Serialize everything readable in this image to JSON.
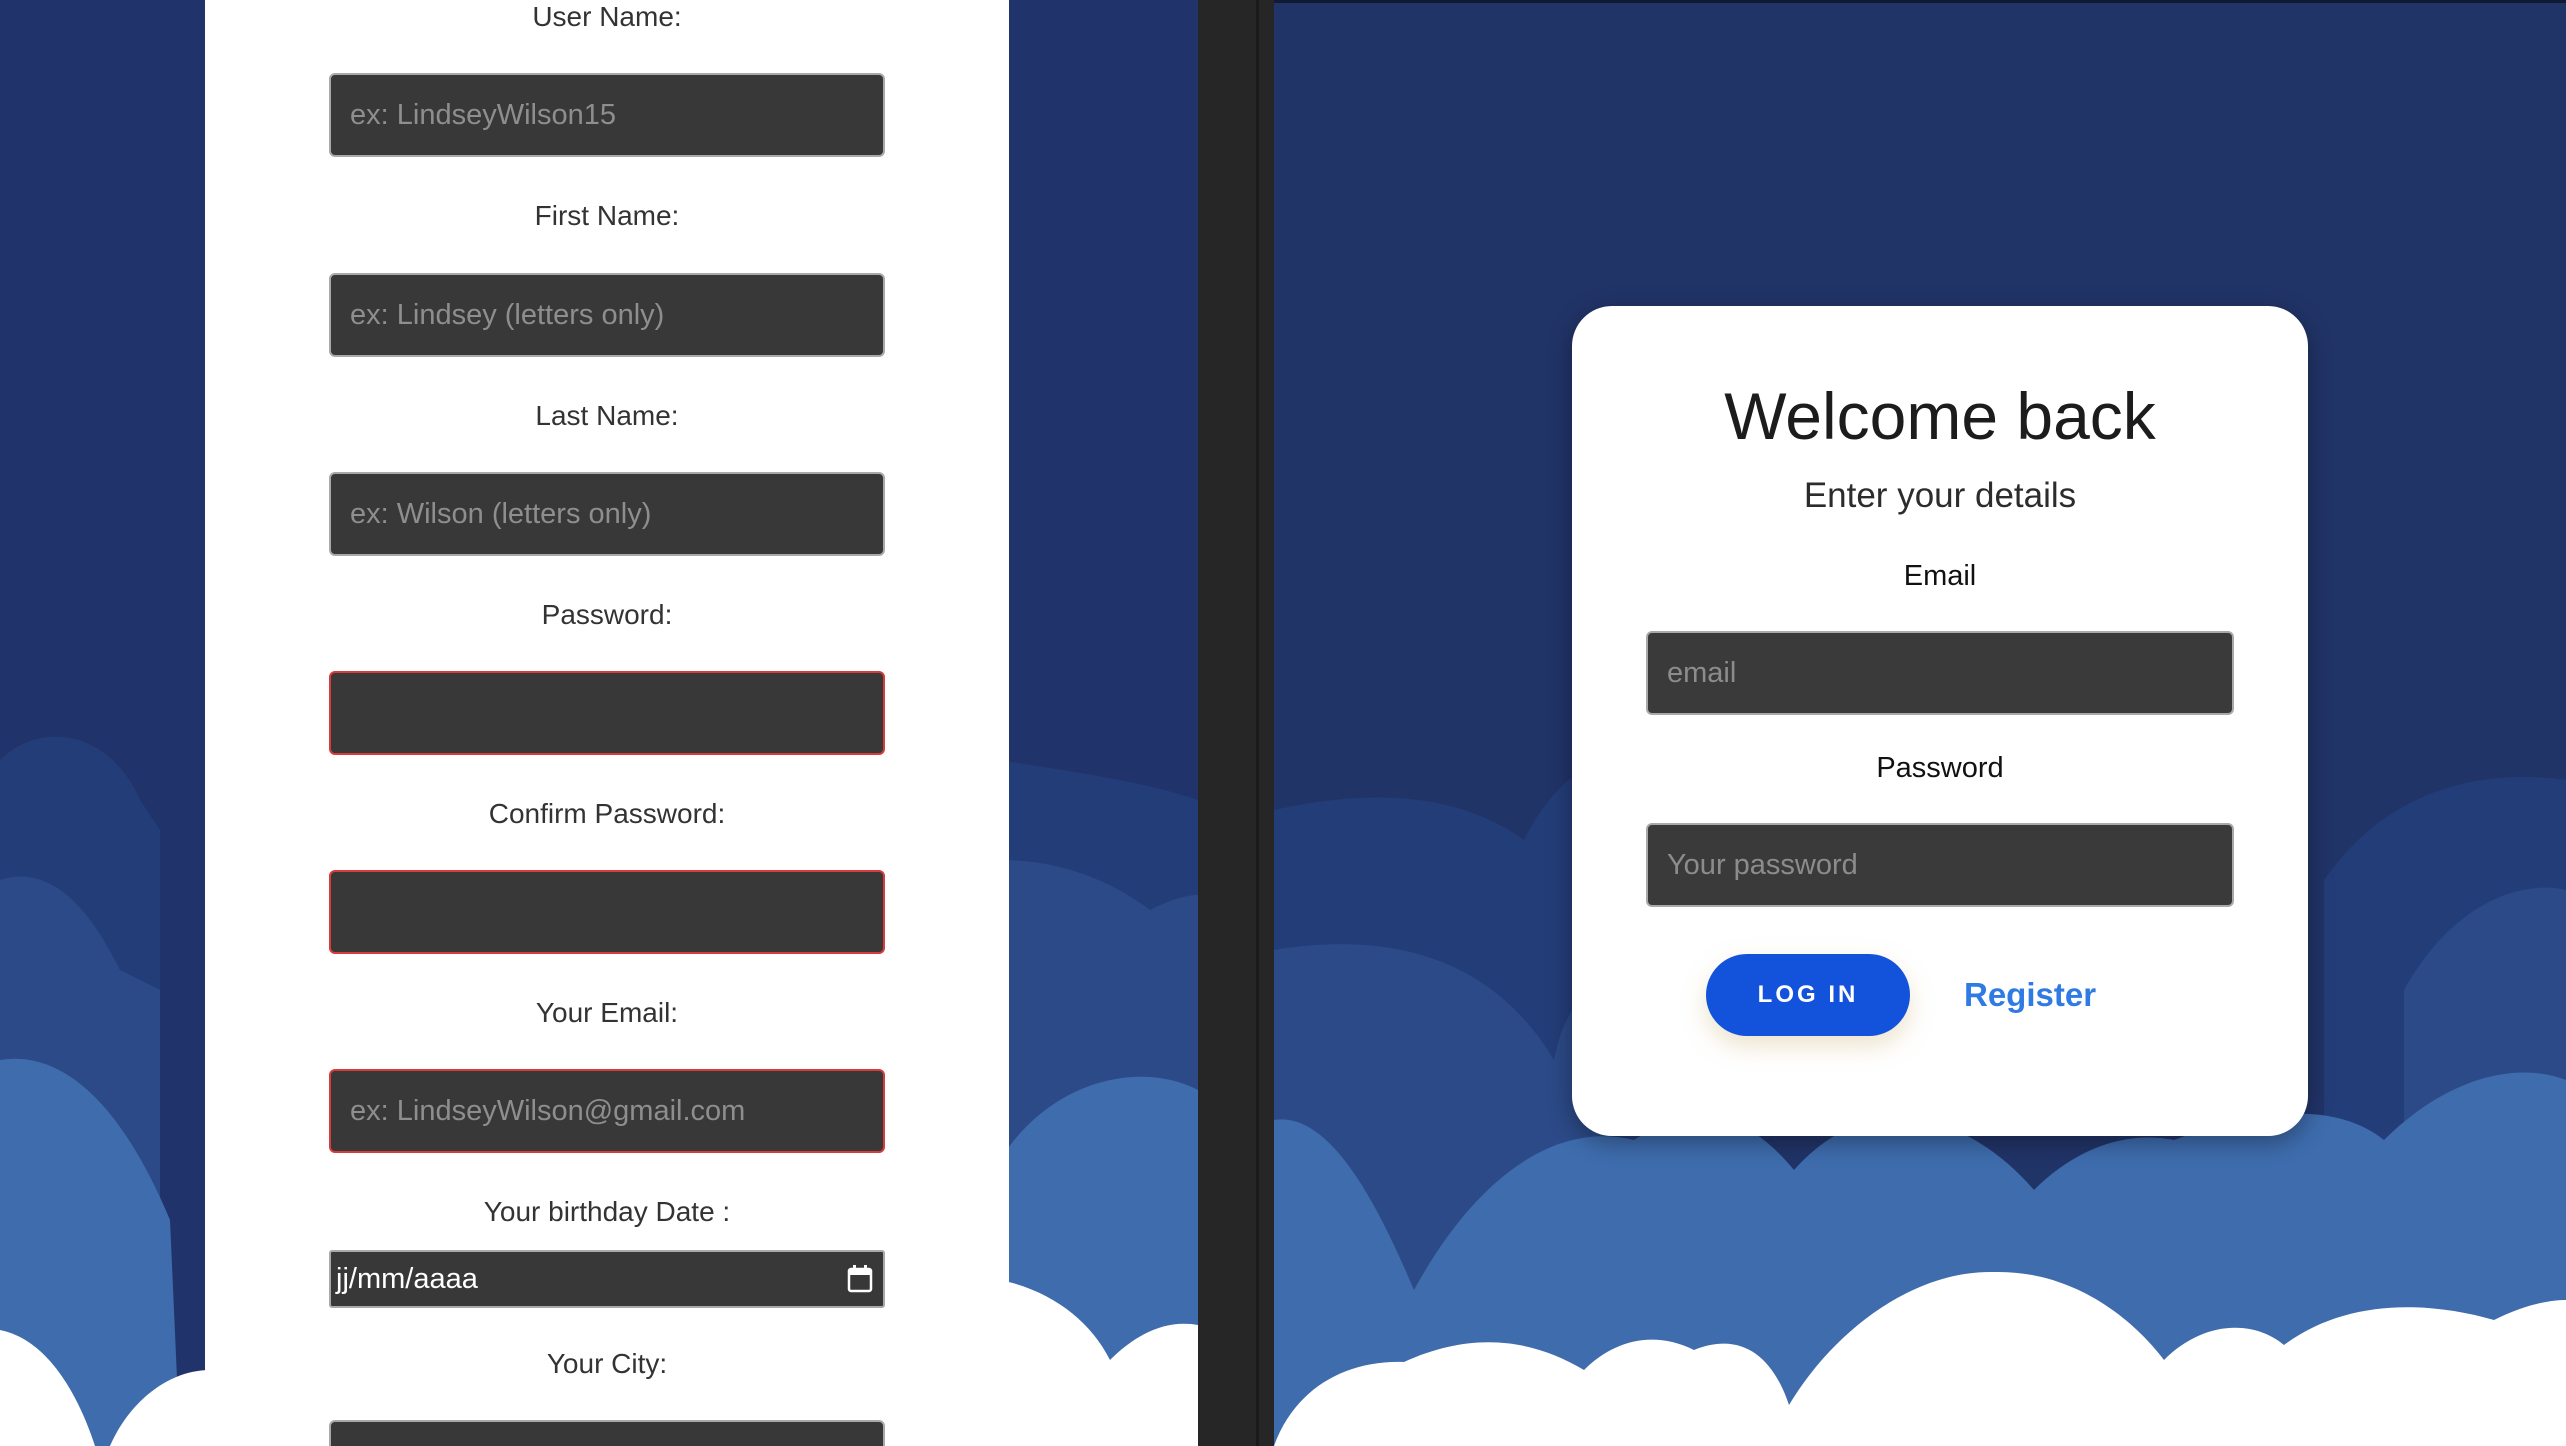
{
  "register_form": {
    "fields": [
      {
        "label": "User Name:",
        "placeholder": "ex: LindseyWilson15"
      },
      {
        "label": "First Name:",
        "placeholder": "ex: Lindsey (letters only)"
      },
      {
        "label": "Last Name:",
        "placeholder": "ex: Wilson  (letters only)"
      },
      {
        "label": "Password:",
        "placeholder": ""
      },
      {
        "label": "Confirm Password:",
        "placeholder": ""
      },
      {
        "label": "Your Email:",
        "placeholder": "ex: LindseyWilson@gmail.com"
      }
    ],
    "birthday": {
      "label": "Your birthday Date :",
      "value": "jj/mm/aaaa"
    },
    "city": {
      "label": "Your City:"
    }
  },
  "login": {
    "title": "Welcome back",
    "subtitle": "Enter your details",
    "email_label": "Email",
    "email_placeholder": "email",
    "password_label": "Password",
    "password_placeholder": "Your password",
    "login_button": "LOG IN",
    "register_link": "Register"
  },
  "colors": {
    "background_navy": "#20336a",
    "button_blue": "#1353dc",
    "link_blue": "#2f7be3",
    "invalid_border": "#d93b3b"
  },
  "icons": {
    "date_picker": "calendar-icon"
  }
}
